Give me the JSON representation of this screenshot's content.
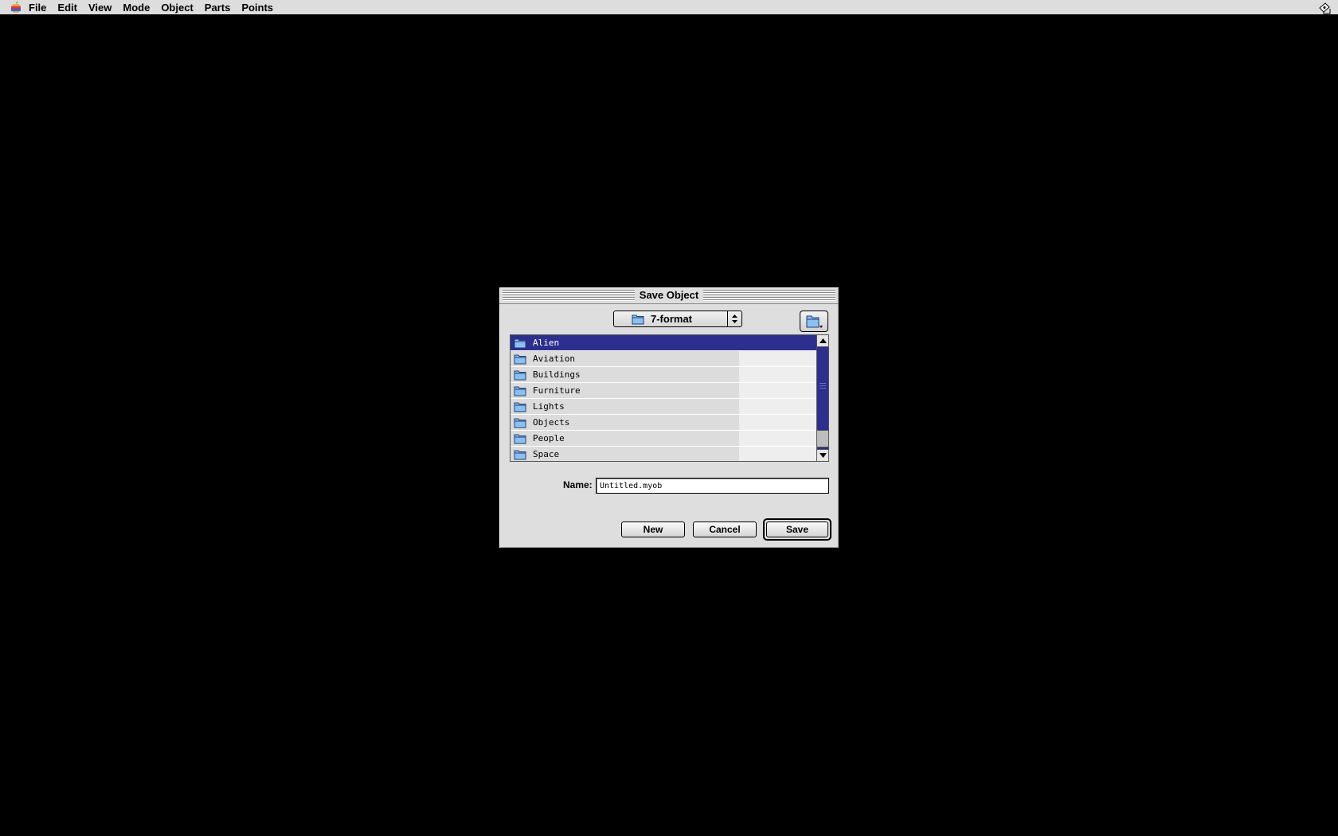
{
  "menubar": {
    "items": [
      "File",
      "Edit",
      "View",
      "Mode",
      "Object",
      "Parts",
      "Points"
    ]
  },
  "dialog": {
    "title": "Save Object",
    "folder_popup": {
      "label": "7-format"
    },
    "files": [
      {
        "name": "Alien",
        "selected": true
      },
      {
        "name": "Aviation"
      },
      {
        "name": "Buildings"
      },
      {
        "name": "Furniture"
      },
      {
        "name": "Lights"
      },
      {
        "name": "Objects"
      },
      {
        "name": "People"
      },
      {
        "name": "Space"
      }
    ],
    "name_label": "Name:",
    "name_value": "Untitled.myob",
    "buttons": {
      "new": "New",
      "cancel": "Cancel",
      "save": "Save"
    }
  },
  "colors": {
    "selection": "#2d2f8e",
    "folder": "#6fa8dc"
  }
}
